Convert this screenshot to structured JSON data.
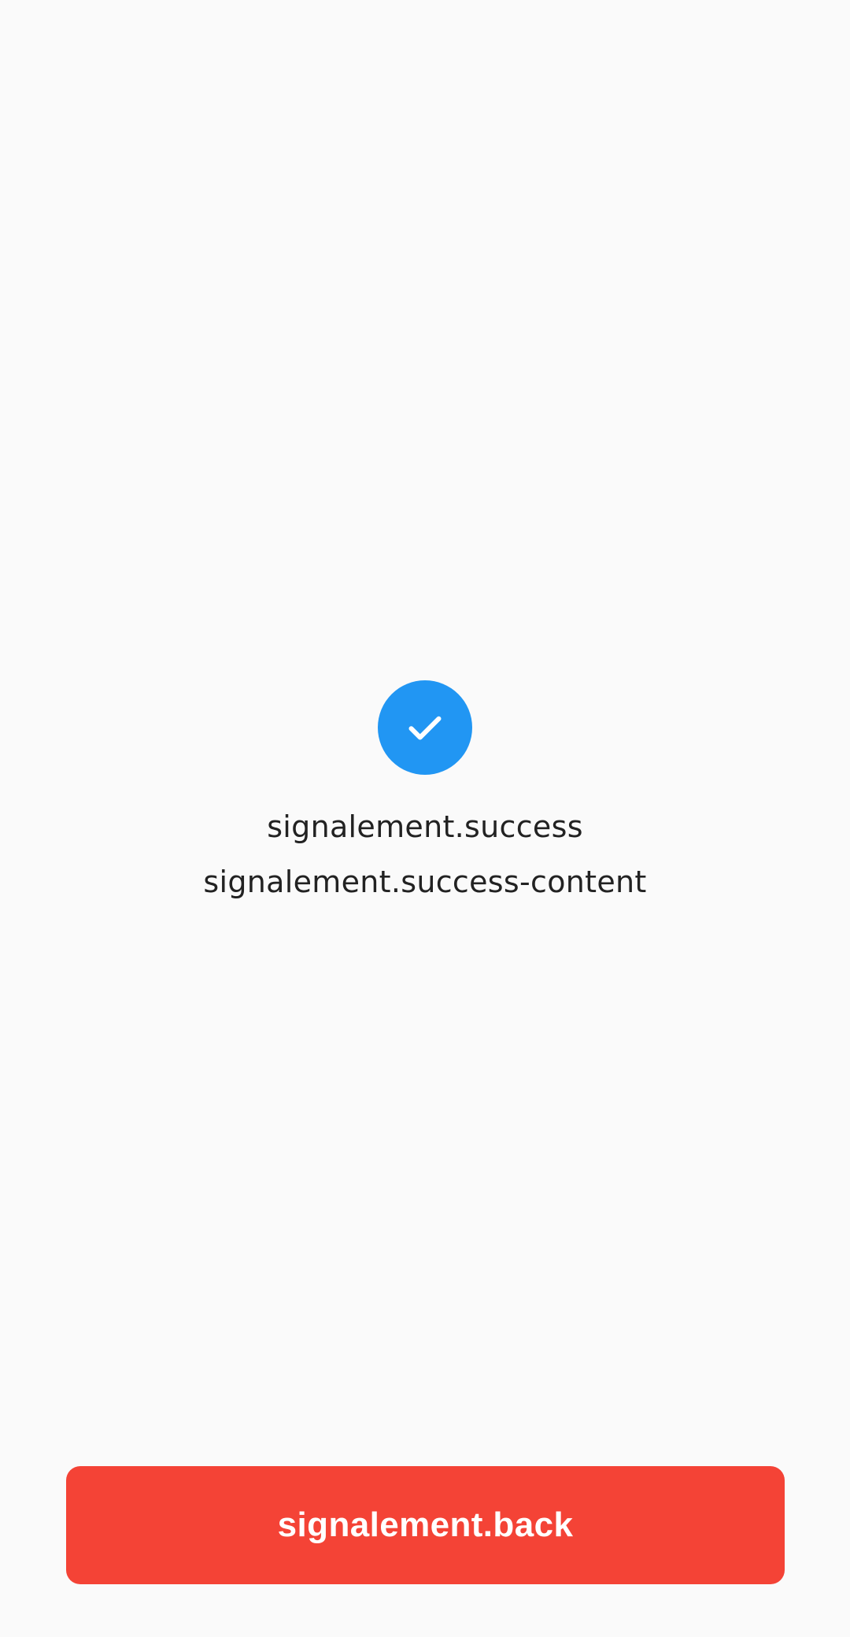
{
  "success": {
    "icon": "check-circle-icon",
    "title": "signalement.success",
    "content": "signalement.success-content"
  },
  "actions": {
    "back_label": "signalement.back"
  },
  "colors": {
    "background": "#fafafa",
    "accent": "#2196f3",
    "button": "#f44336",
    "text": "#222222"
  }
}
